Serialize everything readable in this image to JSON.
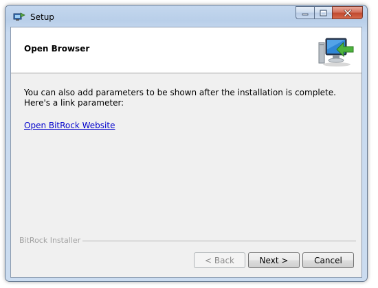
{
  "window": {
    "title": "Setup",
    "accent": "#c4d7ee",
    "close_color": "#c14a2f"
  },
  "header": {
    "title": "Open Browser",
    "icon": "computer-install-icon"
  },
  "body": {
    "line1": "You can also add parameters to be shown after the installation is complete.",
    "line2": "Here's a link parameter:",
    "link_text": "Open BitRock Website",
    "link_color": "#0000cc"
  },
  "footer": {
    "installer_label": "BitRock Installer"
  },
  "buttons": {
    "back": "< Back",
    "next": "Next >",
    "cancel": "Cancel"
  }
}
